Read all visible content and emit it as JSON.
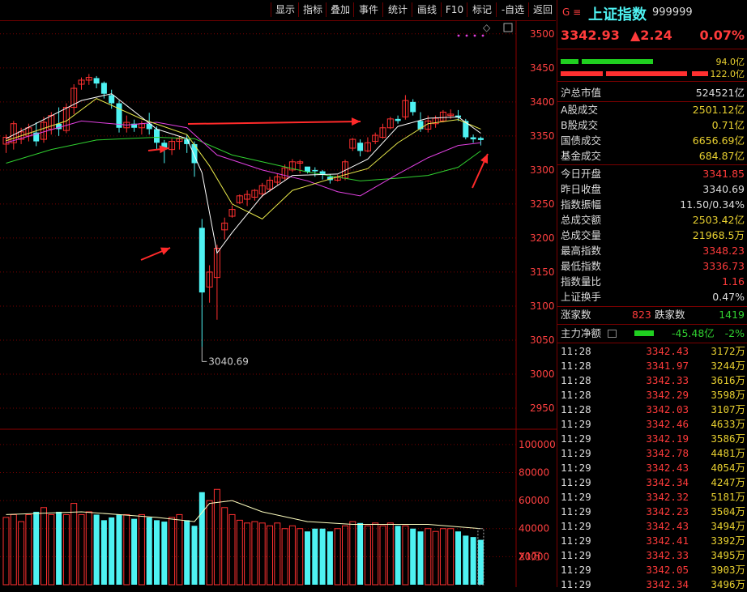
{
  "toolbar": {
    "buttons": [
      "显示",
      "指标",
      "叠加",
      "事件",
      "统计",
      "画线",
      "F10",
      "标记",
      "-自选",
      "返回"
    ]
  },
  "chart": {
    "y_axis_labels": [
      "3500",
      "3450",
      "3400",
      "3350",
      "3300",
      "3250",
      "3200",
      "3150",
      "3100",
      "3050",
      "3000",
      "2950"
    ],
    "vol_axis_labels": [
      "100000",
      "80000",
      "60000",
      "40000",
      "20000"
    ],
    "vol_unit": "X1万",
    "low_annotation": "3040.69",
    "colors": {
      "up": "#ff3030",
      "down": "#4ef2f2",
      "ma5": "#ffffff",
      "ma10": "#e8e84a",
      "ma20": "#e040e0",
      "ma60": "#30d030",
      "arrow": "#ff2a2a"
    }
  },
  "chart_data": {
    "type": "candlestick",
    "candles": [
      [
        3338,
        3348,
        3325,
        3352
      ],
      [
        3340,
        3368,
        3330,
        3372
      ],
      [
        3345,
        3356,
        3338,
        3362
      ],
      [
        3350,
        3362,
        3342,
        3368
      ],
      [
        3355,
        3342,
        3335,
        3370
      ],
      [
        3345,
        3370,
        3340,
        3378
      ],
      [
        3360,
        3380,
        3352,
        3385
      ],
      [
        3368,
        3360,
        3350,
        3392
      ],
      [
        3358,
        3392,
        3354,
        3398
      ],
      [
        3392,
        3420,
        3382,
        3426
      ],
      [
        3426,
        3432,
        3418,
        3436
      ],
      [
        3432,
        3436,
        3425,
        3441
      ],
      [
        3435,
        3427,
        3420,
        3438
      ],
      [
        3428,
        3412,
        3405,
        3430
      ],
      [
        3410,
        3398,
        3390,
        3418
      ],
      [
        3398,
        3362,
        3355,
        3402
      ],
      [
        3362,
        3370,
        3355,
        3380
      ],
      [
        3368,
        3362,
        3356,
        3374
      ],
      [
        3362,
        3368,
        3352,
        3372
      ],
      [
        3368,
        3360,
        3352,
        3384
      ],
      [
        3360,
        3340,
        3330,
        3364
      ],
      [
        3340,
        3330,
        3310,
        3344
      ],
      [
        3330,
        3342,
        3322,
        3346
      ],
      [
        3342,
        3346,
        3330,
        3350
      ],
      [
        3345,
        3338,
        3325,
        3352
      ],
      [
        3338,
        3310,
        3290,
        3342
      ],
      [
        3215,
        3120,
        3040,
        3228
      ],
      [
        3128,
        3150,
        3105,
        3160
      ],
      [
        3142,
        3185,
        3080,
        3190
      ],
      [
        3212,
        3222,
        3198,
        3230
      ],
      [
        3232,
        3242,
        3230,
        3248
      ],
      [
        3252,
        3262,
        3250,
        3264
      ],
      [
        3257,
        3264,
        3247,
        3270
      ],
      [
        3260,
        3270,
        3255,
        3272
      ],
      [
        3265,
        3277,
        3260,
        3281
      ],
      [
        3272,
        3285,
        3268,
        3290
      ],
      [
        3282,
        3290,
        3278,
        3295
      ],
      [
        3288,
        3303,
        3284,
        3308
      ],
      [
        3300,
        3312,
        3297,
        3316
      ],
      [
        3310,
        3312,
        3295,
        3315
      ],
      [
        3305,
        3297,
        3295,
        3302
      ],
      [
        3300,
        3298,
        3290,
        3304
      ],
      [
        3298,
        3294,
        3286,
        3300
      ],
      [
        3290,
        3285,
        3280,
        3294
      ],
      [
        3285,
        3289,
        3283,
        3293
      ],
      [
        3288,
        3312,
        3285,
        3315
      ],
      [
        3332,
        3345,
        3328,
        3347
      ],
      [
        3340,
        3328,
        3320,
        3345
      ],
      [
        3328,
        3340,
        3326,
        3348
      ],
      [
        3342,
        3351,
        3338,
        3355
      ],
      [
        3348,
        3362,
        3346,
        3368
      ],
      [
        3362,
        3375,
        3360,
        3378
      ],
      [
        3375,
        3372,
        3368,
        3380
      ],
      [
        3378,
        3402,
        3374,
        3410
      ],
      [
        3400,
        3385,
        3380,
        3404
      ],
      [
        3372,
        3360,
        3356,
        3385
      ],
      [
        3360,
        3372,
        3355,
        3380
      ],
      [
        3368,
        3376,
        3362,
        3380
      ],
      [
        3372,
        3385,
        3370,
        3388
      ],
      [
        3380,
        3382,
        3375,
        3389
      ],
      [
        3380,
        3377,
        3372,
        3388
      ],
      [
        3372,
        3348,
        3345,
        3375
      ],
      [
        3348,
        3345,
        3340,
        3352
      ],
      [
        3347,
        3344,
        3336,
        3349
      ]
    ],
    "ma5": [
      [
        0,
        3346
      ],
      [
        10,
        3402
      ],
      [
        14,
        3412
      ],
      [
        20,
        3360
      ],
      [
        24,
        3346
      ],
      [
        26,
        3296
      ],
      [
        28,
        3178
      ],
      [
        30,
        3208
      ],
      [
        34,
        3262
      ],
      [
        38,
        3292
      ],
      [
        44,
        3294
      ],
      [
        48,
        3316
      ],
      [
        52,
        3364
      ],
      [
        56,
        3376
      ],
      [
        60,
        3378
      ],
      [
        63,
        3354
      ]
    ],
    "ma10": [
      [
        0,
        3343
      ],
      [
        8,
        3372
      ],
      [
        12,
        3405
      ],
      [
        18,
        3375
      ],
      [
        24,
        3352
      ],
      [
        27,
        3306
      ],
      [
        30,
        3250
      ],
      [
        34,
        3228
      ],
      [
        38,
        3270
      ],
      [
        44,
        3290
      ],
      [
        48,
        3302
      ],
      [
        52,
        3340
      ],
      [
        56,
        3368
      ],
      [
        60,
        3374
      ],
      [
        63,
        3360
      ]
    ],
    "ma20": [
      [
        0,
        3340
      ],
      [
        10,
        3372
      ],
      [
        16,
        3366
      ],
      [
        20,
        3370
      ],
      [
        24,
        3362
      ],
      [
        28,
        3322
      ],
      [
        34,
        3300
      ],
      [
        40,
        3284
      ],
      [
        44,
        3268
      ],
      [
        47,
        3262
      ],
      [
        52,
        3294
      ],
      [
        56,
        3318
      ],
      [
        60,
        3336
      ],
      [
        63,
        3340
      ]
    ],
    "ma60": [
      [
        0,
        3310
      ],
      [
        6,
        3330
      ],
      [
        12,
        3344
      ],
      [
        20,
        3348
      ],
      [
        25,
        3346
      ],
      [
        30,
        3322
      ],
      [
        40,
        3297
      ],
      [
        47,
        3284
      ],
      [
        52,
        3288
      ],
      [
        56,
        3292
      ],
      [
        60,
        3304
      ],
      [
        63,
        3328
      ]
    ],
    "volume": [
      48,
      50,
      45,
      50,
      52,
      55,
      50,
      52,
      50,
      58,
      50,
      52,
      50,
      46,
      48,
      50,
      50,
      47,
      50,
      48,
      46,
      45,
      48,
      50,
      46,
      42,
      66,
      60,
      68,
      55,
      50,
      46,
      44,
      45,
      44,
      42,
      44,
      40,
      42,
      40,
      38,
      40,
      40,
      38,
      40,
      42,
      45,
      44,
      42,
      44,
      42,
      44,
      42,
      42,
      40,
      38,
      40,
      38,
      40,
      40,
      38,
      35,
      34,
      32
    ],
    "vol_ma": [
      [
        0,
        50
      ],
      [
        10,
        52
      ],
      [
        20,
        48
      ],
      [
        25,
        45
      ],
      [
        27,
        58
      ],
      [
        30,
        60
      ],
      [
        34,
        52
      ],
      [
        40,
        45
      ],
      [
        46,
        43
      ],
      [
        56,
        43
      ],
      [
        63,
        40
      ]
    ],
    "ylim": [
      2925,
      3520
    ],
    "vol_ylim": [
      0,
      108
    ]
  },
  "side": {
    "title": "上证指数",
    "code": "999999",
    "prefix": "G ≡",
    "price": "3342.93",
    "change": "▲2.24",
    "change_pct": "0.07%",
    "bar1_value": "94.0亿",
    "bar2_value": "122.0亿",
    "market_cap_label": "沪总市值",
    "market_cap_value": "524521亿",
    "turnover_rows": [
      {
        "label": "A股成交",
        "value": "2501.12亿"
      },
      {
        "label": "B股成交",
        "value": "0.71亿"
      },
      {
        "label": "国债成交",
        "value": "6656.69亿"
      },
      {
        "label": "基金成交",
        "value": "684.87亿"
      }
    ],
    "stat_rows": [
      {
        "label": "今日开盘",
        "value": "3341.85",
        "color": "#ff3b3b"
      },
      {
        "label": "昨日收盘",
        "value": "3340.69",
        "color": "#dddddd"
      },
      {
        "label": "指数振幅",
        "value": "11.50/0.34%",
        "color": "#dddddd"
      },
      {
        "label": "总成交额",
        "value": "2503.42亿",
        "color": "#e8d030"
      },
      {
        "label": "总成交量",
        "value": "21968.5万",
        "color": "#e8d030"
      },
      {
        "label": "最高指数",
        "value": "3348.23",
        "color": "#ff3b3b"
      },
      {
        "label": "最低指数",
        "value": "3336.73",
        "color": "#ff3b3b"
      },
      {
        "label": "指数量比",
        "value": "1.16",
        "color": "#ff3b3b"
      },
      {
        "label": "上证换手",
        "value": "0.47%",
        "color": "#dddddd"
      }
    ],
    "rise_label": "涨家数",
    "rise_value": "823",
    "fall_label": "跌家数",
    "fall_value": "1419",
    "flow_label": "主力净额",
    "flow_value": "-45.48亿",
    "flow_pct": "-2%",
    "ticks": [
      {
        "t": "11:28",
        "p": "3342.43",
        "v": "3172万"
      },
      {
        "t": "11:28",
        "p": "3341.97",
        "v": "3244万"
      },
      {
        "t": "11:28",
        "p": "3342.33",
        "v": "3616万"
      },
      {
        "t": "11:28",
        "p": "3342.29",
        "v": "3598万"
      },
      {
        "t": "11:28",
        "p": "3342.03",
        "v": "3107万"
      },
      {
        "t": "11:29",
        "p": "3342.46",
        "v": "4633万"
      },
      {
        "t": "11:29",
        "p": "3342.19",
        "v": "3586万"
      },
      {
        "t": "11:29",
        "p": "3342.78",
        "v": "4481万"
      },
      {
        "t": "11:29",
        "p": "3342.43",
        "v": "4054万"
      },
      {
        "t": "11:29",
        "p": "3342.34",
        "v": "4247万"
      },
      {
        "t": "11:29",
        "p": "3342.32",
        "v": "5181万"
      },
      {
        "t": "11:29",
        "p": "3342.23",
        "v": "3504万"
      },
      {
        "t": "11:29",
        "p": "3342.43",
        "v": "3494万"
      },
      {
        "t": "11:29",
        "p": "3342.41",
        "v": "3392万"
      },
      {
        "t": "11:29",
        "p": "3342.33",
        "v": "3495万"
      },
      {
        "t": "11:29",
        "p": "3342.05",
        "v": "3903万"
      },
      {
        "t": "11:29",
        "p": "3342.34",
        "v": "3496万"
      }
    ]
  }
}
